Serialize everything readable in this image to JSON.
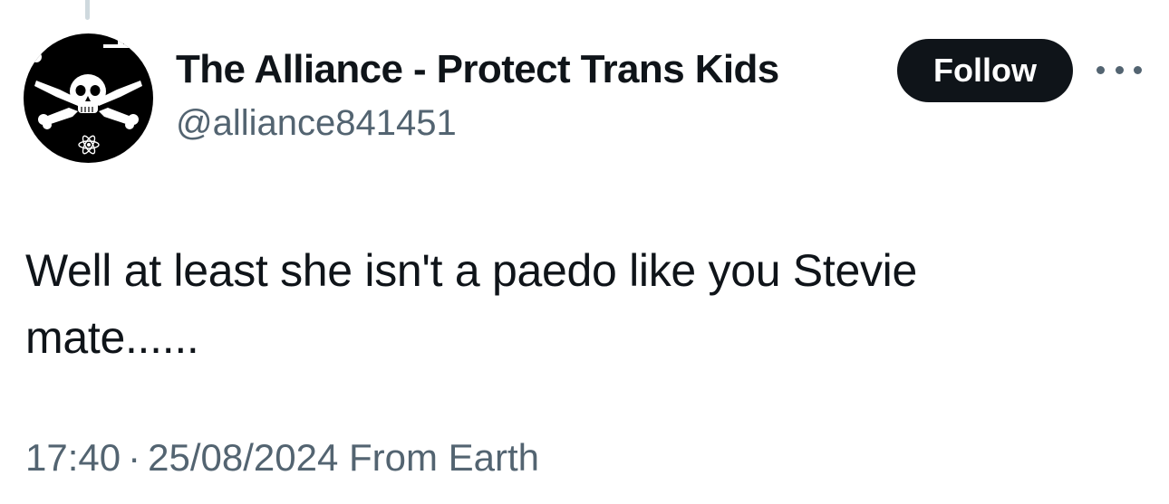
{
  "tweet": {
    "author": {
      "display_name": "The Alliance - Protect Trans Kids",
      "handle": "@alliance841451",
      "avatar_icon": "skull-crossbones-avatar-icon"
    },
    "follow_label": "Follow",
    "more_icon": "more-options-icon",
    "text_line1": "Well at least she isn't a paedo like you Stevie",
    "text_line2": "mate......",
    "time": "17:40",
    "separator": "·",
    "date": "25/08/2024",
    "source": "From Earth"
  },
  "colors": {
    "text_primary": "#0f1419",
    "text_secondary": "#536471",
    "button_bg": "#0f1419",
    "button_text": "#ffffff",
    "thread_line": "#cfd9de"
  }
}
